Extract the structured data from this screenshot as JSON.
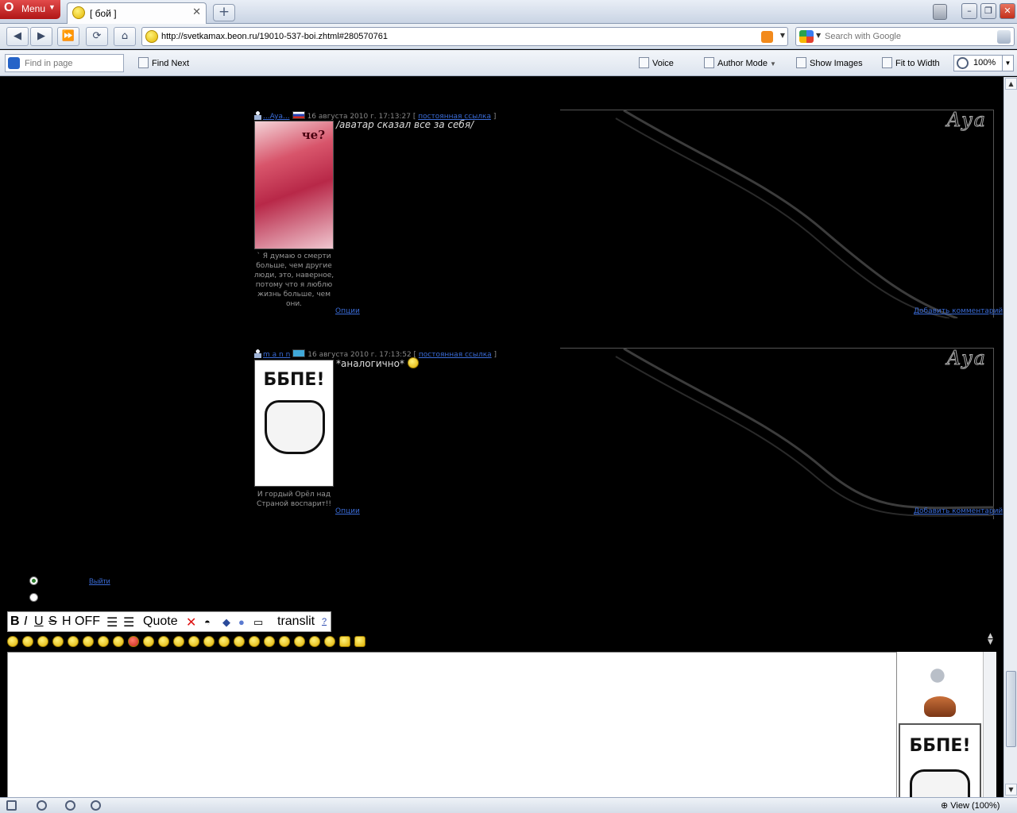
{
  "browser": {
    "menu_label": "Menu",
    "tab_title": "[ бой ]",
    "url": "http://svetkamax.beon.ru/19010-537-boi.zhtml#280570761",
    "search_placeholder": "Search with Google",
    "find_placeholder": "Find in page",
    "find_next": "Find Next",
    "voice": "Voice",
    "author_mode": "Author Mode",
    "show_images": "Show Images",
    "fit_to_width": "Fit to Width",
    "zoom": "100%",
    "status_view": "View (100%)"
  },
  "posts": [
    {
      "author": "...Aya...",
      "date": "16 августа 2010 г. 17:13:27",
      "permalink": "постоянная ссылка",
      "avatar_caption": "че?",
      "text": "/аватар сказал все за себя/",
      "signature": "` Я думаю о смерти больше, чем другие люди, это, наверное, потому что я люблю жизнь больше, чем они.",
      "options": "Опции",
      "add_comment": "Добавить комментарий",
      "banner": "Aya"
    },
    {
      "author": "m a n n",
      "date": "16 августа 2010 г. 17:13:52",
      "permalink": "постоянная ссылка",
      "avatar_caption": "ББПЕ!",
      "text": "*аналогично*",
      "signature": "И гордый Орёл над Страной воспарит!!",
      "options": "Опции",
      "add_comment": "Добавить комментарий",
      "banner": "Aya"
    }
  ],
  "logout": "Выйти",
  "editor_toolbar": {
    "bold": "B",
    "italic": "I",
    "underline": "U",
    "strike": "S",
    "heading": "H",
    "off": "OFF",
    "quote": "Quote",
    "translit": "translit",
    "help": "?"
  },
  "side_panel": {
    "avatar_caption": "ББПЕ!"
  }
}
